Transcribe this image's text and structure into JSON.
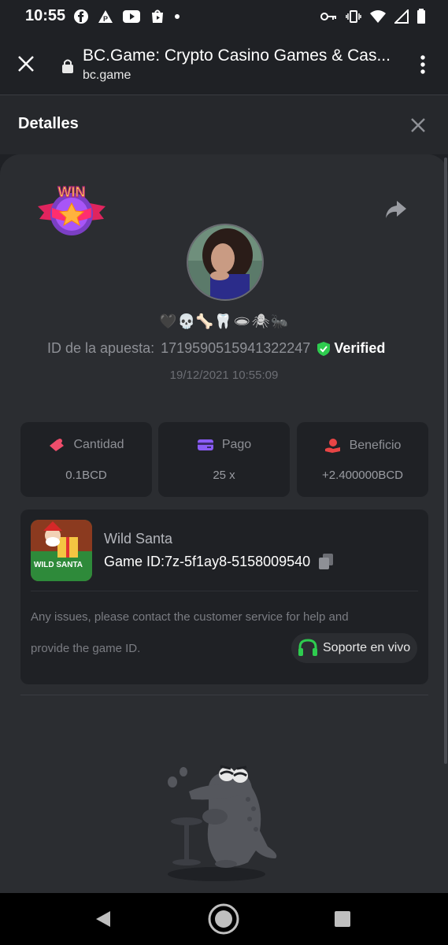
{
  "status_bar": {
    "time": "10:55"
  },
  "browser": {
    "title": "BC.Game: Crypto Casino Games & Cas...",
    "url": "bc.game"
  },
  "modal": {
    "title": "Detalles"
  },
  "bet": {
    "emoji_name": "🖤💀🦴🦷🕳🕷🐜",
    "bet_id_label": "ID de la apuesta:",
    "bet_id": "1719590515941322247",
    "verified": "Verified",
    "datetime": "19/12/2021 10:55:09"
  },
  "stats": [
    {
      "label": "Cantidad",
      "value": "0.1BCD",
      "icon": "money-icon",
      "color": "#ef4d6b"
    },
    {
      "label": "Pago",
      "value": "25 x",
      "icon": "card-icon",
      "color": "#8a5cf6"
    },
    {
      "label": "Beneficio",
      "value": "+2.400000BCD",
      "icon": "profit-hand-icon",
      "color": "#e84545"
    }
  ],
  "game": {
    "name": "Wild Santa",
    "game_id_label": "Game ID:",
    "game_id": "7z-5f1ay8-5158009540",
    "issues_line1": "Any issues, please contact the customer service for help and",
    "issues_line2": "provide the game ID.",
    "support_label": "Soporte en vivo",
    "thumb_text": "WILD SANTA"
  },
  "badge": {
    "text": "WIN"
  },
  "colors": {
    "verified_green": "#2ecc4f",
    "support_green": "#2ecc4f",
    "accent_bg": "#2b2d31"
  }
}
